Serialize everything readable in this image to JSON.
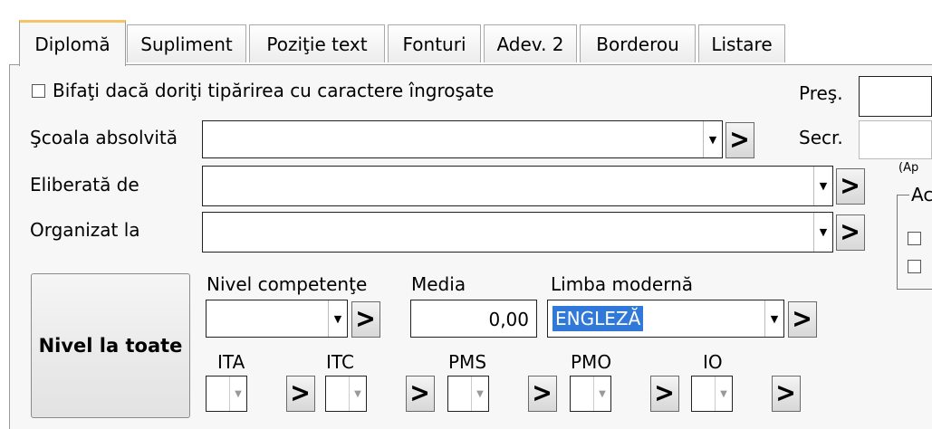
{
  "tabs": [
    {
      "label": "Diplomă",
      "active": true
    },
    {
      "label": "Supliment",
      "active": false
    },
    {
      "label": "Poziţie text",
      "active": false
    },
    {
      "label": "Fonturi",
      "active": false
    },
    {
      "label": "Adev. 2",
      "active": false
    },
    {
      "label": "Borderou",
      "active": false
    },
    {
      "label": "Listare",
      "active": false
    }
  ],
  "bold_checkbox": {
    "label": "Bifaţi dacă doriţi tipărirea cu caractere îngroşate",
    "checked": false
  },
  "fields": {
    "scoala": {
      "label": "Şcoala absolvită",
      "value": ""
    },
    "eliberata": {
      "label": "Eliberată de",
      "value": ""
    },
    "organizat": {
      "label": "Organizat la",
      "value": ""
    }
  },
  "right": {
    "pres_label": "Preş.",
    "secr_label": "Secr.",
    "ap_note": "(Ap",
    "group_label": "Ac"
  },
  "nivel_btn": "Nivel la toate",
  "nivel_competente": {
    "label": "Nivel competenţe",
    "value": ""
  },
  "media": {
    "label": "Media",
    "value": "0,00"
  },
  "limba": {
    "label": "Limba modernă",
    "value": "ENGLEZĂ"
  },
  "small_fields": [
    {
      "label": "ITA",
      "value": ""
    },
    {
      "label": "ITC",
      "value": ""
    },
    {
      "label": "PMS",
      "value": ""
    },
    {
      "label": "PMO",
      "value": ""
    },
    {
      "label": "IO",
      "value": ""
    }
  ],
  "go_glyph": ">",
  "dropdown_glyph": "▼",
  "colors": {
    "selection": "#3079d8",
    "tab_accent": "#f5c36a"
  }
}
